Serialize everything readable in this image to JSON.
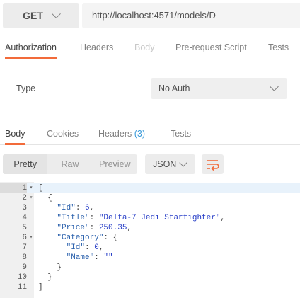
{
  "request": {
    "method": "GET",
    "url": "http://localhost:4571/models/D"
  },
  "request_tabs": [
    "Authorization",
    "Headers",
    "Body",
    "Pre-request Script",
    "Tests"
  ],
  "auth": {
    "type_label": "Type",
    "type_value": "No Auth"
  },
  "response_tabs": {
    "body": "Body",
    "cookies": "Cookies",
    "headers": "Headers",
    "headers_count": "(3)",
    "tests": "Tests"
  },
  "view_modes": [
    "Pretty",
    "Raw",
    "Preview"
  ],
  "format": "JSON",
  "code_lines": [
    "[",
    "  {",
    "    \"Id\": 6,",
    "    \"Title\": \"Delta-7 Jedi Starfighter\",",
    "    \"Price\": 250.35,",
    "    \"Category\": {",
    "      \"Id\": 0,",
    "      \"Name\": \"\"",
    "    }",
    "  }",
    "]"
  ],
  "colors": {
    "accent": "#f26b3a",
    "count": "#3a9ad9",
    "json_key": "#2c62ad",
    "json_value": "#2a40c8"
  }
}
